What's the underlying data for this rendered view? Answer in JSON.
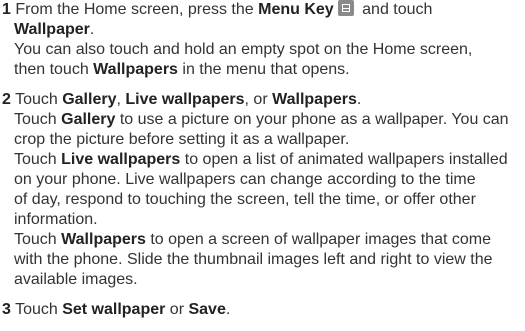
{
  "steps": [
    {
      "number": "1",
      "line1_a": "From the Home screen, press the ",
      "line1_bold": "Menu Key",
      "line1_b": " and touch",
      "line2_bold": "Wallpaper",
      "line2_a": ".",
      "note_line1": "You can also touch and hold an empty spot on the Home screen,",
      "note_line2_a": "then touch ",
      "note_line2_bold": "Wallpapers",
      "note_line2_b": " in the menu that opens."
    },
    {
      "number": "2",
      "line1_a": "Touch ",
      "opt1": "Gallery",
      "sep1": ", ",
      "opt2": "Live wallpapers",
      "sep2": ", or ",
      "opt3": "Wallpapers",
      "end": ".",
      "gallery_l1_a": "Touch ",
      "gallery_l1_bold": "Gallery",
      "gallery_l1_b": " to use a picture on your phone as a wallpaper. You can",
      "gallery_l2": "crop the picture before setting it as a wallpaper.",
      "live_l1_a": "Touch ",
      "live_l1_bold": "Live wallpapers",
      "live_l1_b": " to open a list of animated wallpapers installed",
      "live_l2": "on your phone. Live wallpapers can change according to the time",
      "live_l3": "of day, respond to touching the screen, tell the time, or offer other",
      "live_l4": "information.",
      "wall_l1_a": "Touch ",
      "wall_l1_bold": "Wallpapers",
      "wall_l1_b": " to open a screen of wallpaper images that come",
      "wall_l2": "with the phone. Slide the thumbnail images left and right to view the",
      "wall_l3": "available images."
    },
    {
      "number": "3",
      "line1_a": "Touch ",
      "opt1": "Set wallpaper",
      "sep1": " or ",
      "opt2": "Save",
      "end": "."
    }
  ],
  "icons": {
    "menu_key": "menu-key-icon"
  }
}
